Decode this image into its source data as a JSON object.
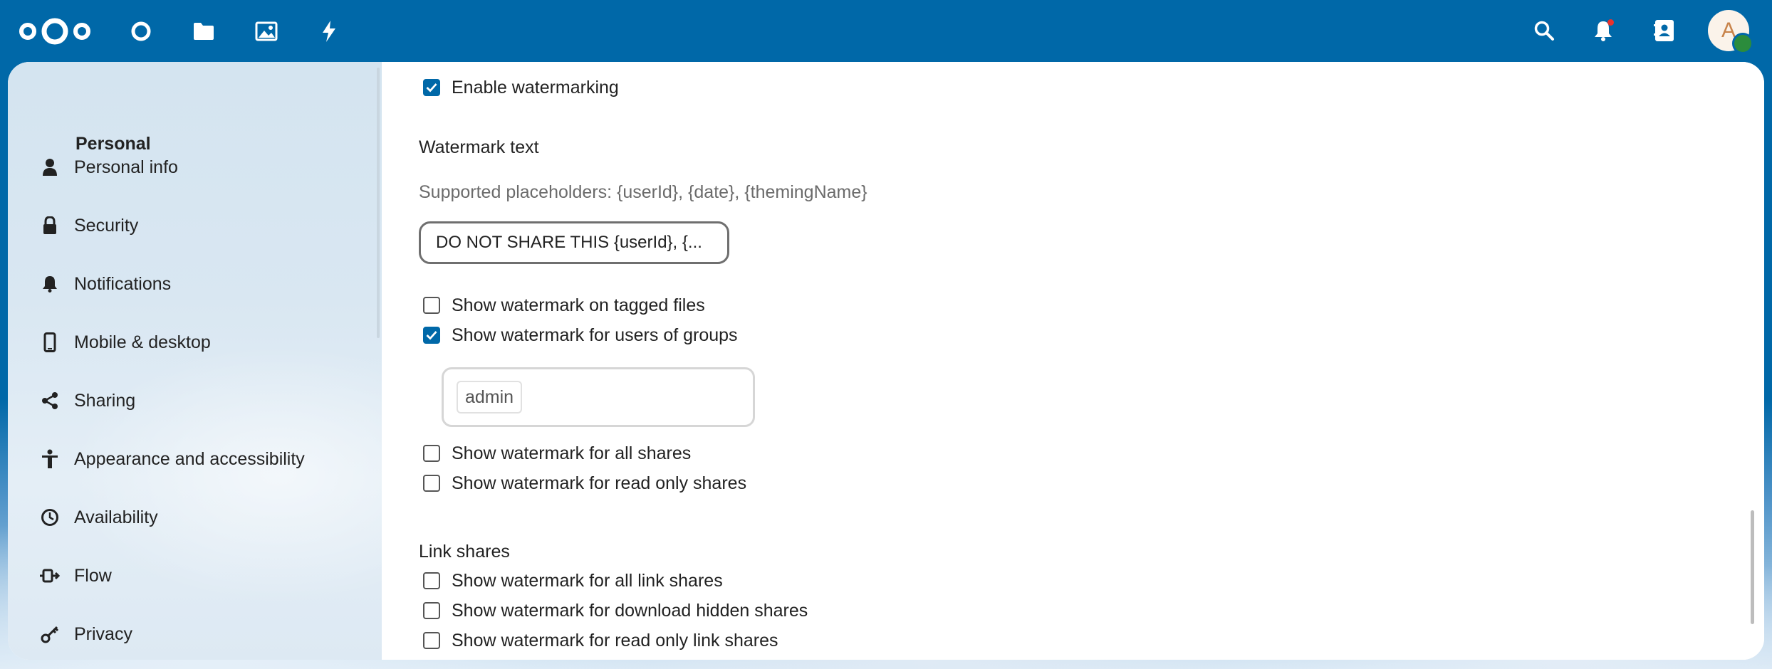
{
  "header": {
    "apps": [
      {
        "name": "dashboard",
        "icon": "circle-outline-icon"
      },
      {
        "name": "files",
        "icon": "folder-icon"
      },
      {
        "name": "photos",
        "icon": "image-icon"
      },
      {
        "name": "activity",
        "icon": "lightning-icon"
      }
    ],
    "avatar_initial": "A",
    "accent_color": "#0068a8"
  },
  "sidebar": {
    "title": "Personal",
    "items": [
      {
        "label": "Personal info",
        "icon": "person-icon"
      },
      {
        "label": "Security",
        "icon": "lock-icon"
      },
      {
        "label": "Notifications",
        "icon": "bell-icon"
      },
      {
        "label": "Mobile & desktop",
        "icon": "phone-icon"
      },
      {
        "label": "Sharing",
        "icon": "share-icon"
      },
      {
        "label": "Appearance and accessibility",
        "icon": "accessibility-icon"
      },
      {
        "label": "Availability",
        "icon": "clock-icon"
      },
      {
        "label": "Flow",
        "icon": "flow-icon"
      },
      {
        "label": "Privacy",
        "icon": "key-icon"
      }
    ]
  },
  "main": {
    "enable_watermarking": {
      "label": "Enable watermarking",
      "checked": true
    },
    "watermark_text_label": "Watermark text",
    "placeholders_hint": "Supported placeholders: {userId}, {date}, {themingName}",
    "watermark_text_value": "DO NOT SHARE THIS {userId}, {...",
    "options": [
      {
        "label": "Show watermark on tagged files",
        "checked": false
      },
      {
        "label": "Show watermark for users of groups",
        "checked": true
      }
    ],
    "groups": [
      "admin"
    ],
    "share_options": [
      {
        "label": "Show watermark for all shares",
        "checked": false
      },
      {
        "label": "Show watermark for read only shares",
        "checked": false
      }
    ],
    "link_shares_label": "Link shares",
    "link_options": [
      {
        "label": "Show watermark for all link shares",
        "checked": false
      },
      {
        "label": "Show watermark for download hidden shares",
        "checked": false
      },
      {
        "label": "Show watermark for read only link shares",
        "checked": false
      }
    ]
  }
}
